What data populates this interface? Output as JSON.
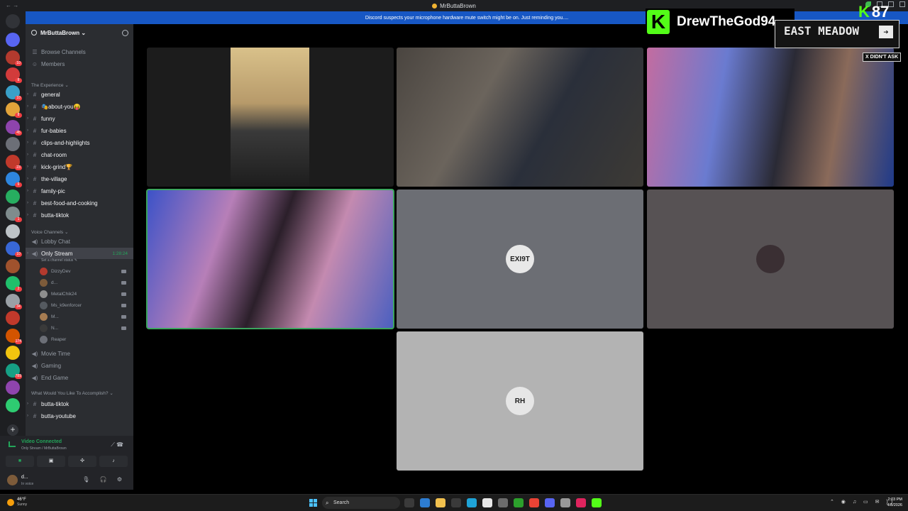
{
  "window": {
    "title": "MrButtaBrown",
    "back_glyph": "← →"
  },
  "notice": "Discord suspects your microphone hardware mute switch might be on. Just reminding you....",
  "rail": {
    "servers": [
      {
        "color": "#5865f2",
        "badge": ""
      },
      {
        "color": "#b33a2e",
        "badge": "10"
      },
      {
        "color": "#d23b3b",
        "badge": "8"
      },
      {
        "color": "#3aa0c8",
        "badge": "10"
      },
      {
        "color": "#e2a33a",
        "badge": "8"
      },
      {
        "color": "#8e44ad",
        "badge": "45"
      },
      {
        "color": "#6c6f77",
        "badge": ""
      },
      {
        "color": "#c0392b",
        "badge": "23"
      },
      {
        "color": "#2e86de",
        "badge": "6"
      },
      {
        "color": "#27ae60",
        "badge": ""
      },
      {
        "color": "#7f8c8d",
        "badge": "1"
      },
      {
        "color": "#bdc3c7",
        "badge": ""
      },
      {
        "color": "#3867d6",
        "badge": "10"
      },
      {
        "color": "#a0522d",
        "badge": ""
      },
      {
        "color": "#20bf6b",
        "badge": "2"
      },
      {
        "color": "#9aa0a6",
        "badge": "34"
      },
      {
        "color": "#c0392b",
        "badge": ""
      },
      {
        "color": "#d35400",
        "badge": "174"
      },
      {
        "color": "#f1c40f",
        "badge": ""
      },
      {
        "color": "#16a085",
        "badge": "789"
      },
      {
        "color": "#8e44ad",
        "badge": ""
      },
      {
        "color": "#2ecc71",
        "badge": ""
      }
    ]
  },
  "server": {
    "name": "MrButtaBrown ⌄"
  },
  "sidebar": {
    "top_links": [
      "Browse Channels",
      "Members"
    ],
    "category_experience": "The Experience ⌄",
    "text_channels": [
      "general",
      "🎭about-you😝",
      "funny",
      "fur-babies",
      "clips-and-highlights",
      "chat-room",
      "kick-grind🏆",
      "the-village",
      "family-pic",
      "best-food-and-cooking",
      "butta-tiktok"
    ],
    "category_voice": "Voice Channels ⌄",
    "voice_lobby": "Lobby Chat",
    "active_voice": {
      "name": "Only Stream",
      "timer": "1:28:24",
      "status": "Set a channel status ✎"
    },
    "voice_users": [
      {
        "name": "DizzyDev",
        "color": "#b33a2e"
      },
      {
        "name": "d...",
        "color": "#7d5b3a"
      },
      {
        "name": "MetalChik24",
        "color": "#8e8e8e"
      },
      {
        "name": "Ms_k9enforcer",
        "color": "#555a60"
      },
      {
        "name": "M...",
        "color": "#a67c52"
      },
      {
        "name": "N...",
        "color": "#3a3a3a"
      },
      {
        "name": "Reaper",
        "color": "#6c6f77"
      }
    ],
    "voice_more": [
      "Movie Time",
      "Gaming",
      "End Game"
    ],
    "category_accomplish": "What Would You Like To Accomplish? ⌄",
    "accomplish_channels": [
      "butta-tiktok",
      "butta-youtube"
    ]
  },
  "voice_panel": {
    "title": "Video Connected",
    "subtitle": "Only Stream / MrButtaBrown"
  },
  "user_panel": {
    "name": "d...",
    "status": "In voice"
  },
  "tiles": [
    {
      "kind": "video",
      "label": "cam-1"
    },
    {
      "kind": "video",
      "label": "cam-2"
    },
    {
      "kind": "video",
      "label": "cam-3"
    },
    {
      "kind": "video",
      "label": "cam-4"
    },
    {
      "kind": "avatar",
      "avatar_text": "EXI9T"
    },
    {
      "kind": "avatar",
      "avatar_text": ""
    },
    {
      "kind": "avatar",
      "avatar_text": "RH"
    }
  ],
  "overlay": {
    "streamer": "DrewTheGod94",
    "viewers": "87",
    "kick_letter": "K",
    "banner": "EAST MEADOW",
    "tag": "X DIDN'T ASK"
  },
  "taskbar": {
    "temp": "46°F",
    "weather": "Sunny",
    "search_placeholder": "Search",
    "time": "2:03 PM",
    "date": "4/8/2026"
  }
}
